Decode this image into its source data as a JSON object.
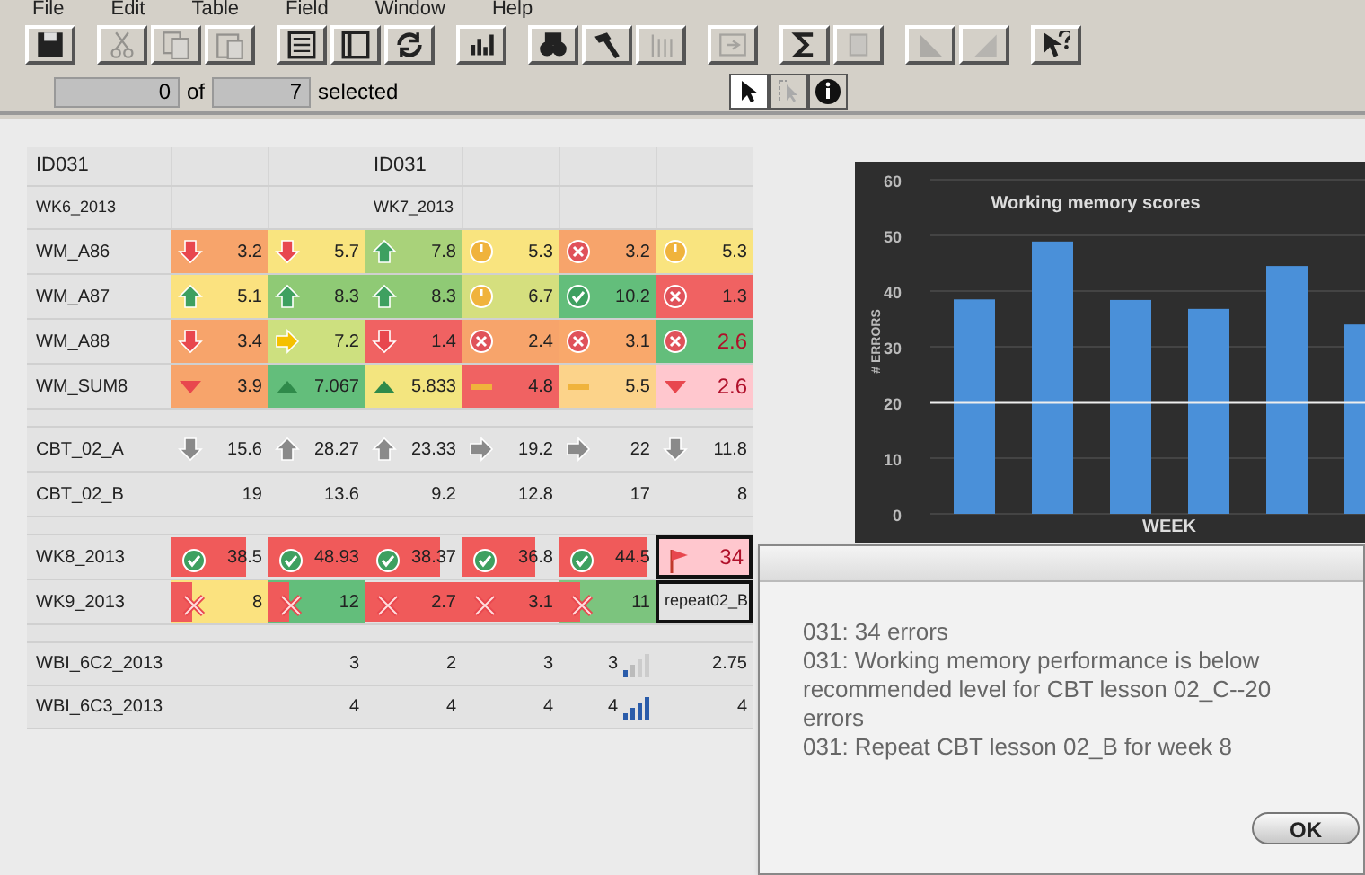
{
  "menu": [
    "File",
    "Edit",
    "Table",
    "Field",
    "Window",
    "Help"
  ],
  "toolbar": {
    "buttons": [
      {
        "kind": "save"
      },
      {
        "kind": "cut"
      },
      {
        "kind": "copy"
      },
      {
        "kind": "paste"
      },
      {
        "kind": "list"
      },
      {
        "kind": "form"
      },
      {
        "kind": "refresh"
      },
      {
        "kind": "chart"
      },
      {
        "kind": "find"
      },
      {
        "kind": "hammer"
      },
      {
        "kind": "sort"
      },
      {
        "kind": "import"
      },
      {
        "kind": "sum"
      },
      {
        "kind": "page"
      },
      {
        "kind": "triangle"
      },
      {
        "kind": "triangle2"
      },
      {
        "kind": "help"
      }
    ]
  },
  "selection": {
    "count": "0",
    "of": "of",
    "total": "7",
    "label": "selected"
  },
  "tools": [
    {
      "kind": "pointer",
      "selected": true
    },
    {
      "kind": "select",
      "selected": false
    },
    {
      "kind": "info",
      "selected": false
    }
  ],
  "header": [
    {
      "id": "ID031",
      "week": "WK6_2013"
    },
    {
      "id": "ID031",
      "week": "WK7_2013"
    }
  ],
  "rows": [
    {
      "kind": "heat",
      "label": "WM_A86",
      "cells": [
        {
          "kind": "down",
          "color": "#f7a46b",
          "value": "3.2",
          "alert": false
        },
        {
          "kind": "down",
          "color": "#f9e47f",
          "value": "5.7",
          "alert": false
        },
        {
          "kind": "up",
          "color": "#a9d27a",
          "value": "7.8",
          "alert": false
        },
        {
          "kind": "neutral",
          "color": "#f9e47f",
          "value": "5.3",
          "alert": false
        },
        {
          "kind": "cross",
          "color": "#f7a46b",
          "value": "3.2",
          "alert": false
        },
        {
          "kind": "neutral",
          "color": "#f9e47f",
          "value": "5.3",
          "alert": false
        }
      ]
    },
    {
      "kind": "heat",
      "label": "WM_A87",
      "cells": [
        {
          "kind": "up",
          "color": "#fbe27f",
          "value": "5.1",
          "alert": false
        },
        {
          "kind": "up",
          "color": "#8fca75",
          "value": "8.3",
          "alert": false
        },
        {
          "kind": "up",
          "color": "#8fca75",
          "value": "8.3",
          "alert": false
        },
        {
          "kind": "neutral",
          "color": "#d5df7e",
          "value": "6.7",
          "alert": false
        },
        {
          "kind": "check",
          "color": "#63be7b",
          "value": "10.2",
          "alert": false
        },
        {
          "kind": "cross",
          "color": "#f06262",
          "value": "1.3",
          "alert": false
        }
      ]
    },
    {
      "kind": "heat",
      "label": "WM_A88",
      "cells": [
        {
          "kind": "down",
          "color": "#f7a46b",
          "value": "3.4",
          "alert": false
        },
        {
          "kind": "right",
          "color": "#cde07f",
          "value": "7.2",
          "alert": false
        },
        {
          "kind": "down",
          "color": "#f06262",
          "value": "1.4",
          "alert": false
        },
        {
          "kind": "cross",
          "color": "#f7a46b",
          "value": "2.4",
          "alert": false
        },
        {
          "kind": "cross",
          "color": "#f9a86b",
          "value": "3.1",
          "alert": false
        },
        {
          "kind": "cross",
          "color": "#63be7b",
          "value": "2.6",
          "alert": true
        }
      ]
    },
    {
      "kind": "heat",
      "label": "WM_SUM8",
      "cells": [
        {
          "kind": "tri-down",
          "color": "#f7a46b",
          "value": "3.9",
          "alert": false
        },
        {
          "kind": "tri-up",
          "color": "#63be7b",
          "value": "7.067",
          "alert": false
        },
        {
          "kind": "tri-up",
          "color": "#f3e57f",
          "value": "5.833",
          "alert": false
        },
        {
          "kind": "dash",
          "color": "#f06262",
          "value": "4.8",
          "alert": false
        },
        {
          "kind": "dash",
          "color": "#fcd38a",
          "value": "5.5",
          "alert": false
        },
        {
          "kind": "tri-down",
          "color": "#ffc7ce",
          "value": "2.6",
          "alert": true
        }
      ]
    },
    {
      "kind": "gap"
    },
    {
      "kind": "plain",
      "label": "CBT_02_A",
      "cells": [
        {
          "kind": "down",
          "value": "15.6"
        },
        {
          "kind": "up",
          "value": "28.27"
        },
        {
          "kind": "up",
          "value": "23.33"
        },
        {
          "kind": "right",
          "value": "19.2"
        },
        {
          "kind": "right",
          "value": "22"
        },
        {
          "kind": "down",
          "value": "11.8"
        }
      ]
    },
    {
      "kind": "plain",
      "label": "CBT_02_B",
      "cells": [
        {
          "value": "19"
        },
        {
          "value": "13.6"
        },
        {
          "value": "9.2"
        },
        {
          "value": "12.8"
        },
        {
          "value": "17"
        },
        {
          "value": "8"
        }
      ]
    },
    {
      "kind": "gap"
    },
    {
      "kind": "bars",
      "label": "WK8_2013",
      "cells": [
        {
          "kind": "check",
          "value": "38.5",
          "selected": false
        },
        {
          "kind": "check",
          "value": "48.93",
          "selected": false
        },
        {
          "kind": "check",
          "value": "38.37",
          "selected": false
        },
        {
          "kind": "check",
          "value": "36.8",
          "selected": false
        },
        {
          "kind": "check",
          "value": "44.5",
          "selected": false
        },
        {
          "kind": "flag",
          "color": "#ffc7ce",
          "value": "34",
          "alert": true,
          "selected": true
        }
      ]
    },
    {
      "kind": "bars",
      "label": "WK9_2013",
      "cells": [
        {
          "kind": "cross",
          "color": "#fbe27f",
          "value": "8",
          "selected": false
        },
        {
          "kind": "cross",
          "color": "#63be7b",
          "value": "12",
          "selected": false
        },
        {
          "kind": "cross",
          "value": "2.7",
          "selected": false
        },
        {
          "kind": "cross",
          "value": "3.1",
          "selected": false
        },
        {
          "kind": "cross",
          "color": "#7cc47e",
          "value": "11",
          "selected": false
        },
        {
          "kind": "note",
          "value": "repeat02_B",
          "selected": true
        }
      ]
    },
    {
      "kind": "gap"
    },
    {
      "kind": "score",
      "label": "WBI_6C2_2013",
      "cells": [
        {
          "value": "3"
        },
        {
          "value": "2"
        },
        {
          "value": "3"
        },
        {
          "value": "3",
          "kind": "bars-low"
        },
        {
          "value": "2.75"
        }
      ]
    },
    {
      "kind": "score",
      "label": "WBI_6C3_2013",
      "cells": [
        {
          "value": "4"
        },
        {
          "value": "4"
        },
        {
          "value": "4"
        },
        {
          "value": "4",
          "kind": "bars-full"
        },
        {
          "value": "4"
        }
      ]
    }
  ],
  "chart": {
    "chart_data": {
      "type": "bar",
      "title": "Working memory scores",
      "xlabel": "WEEK",
      "ylabel": "# ERRORS",
      "series": [
        {
          "color": "#4a90d9",
          "values": [
            38.5,
            48.9,
            38.4,
            36.8,
            44.5,
            34
          ]
        }
      ],
      "ylim": [
        0,
        60
      ],
      "yticks": [
        0,
        10,
        20,
        30,
        40,
        50,
        60
      ],
      "grid": true,
      "ref_lines": [
        {
          "axis": "y",
          "value": 20
        }
      ]
    }
  },
  "dialog": {
    "lines": [
      "031: 34 errors",
      "031: Working memory performance is below recommended level for CBT lesson 02_C--20 errors",
      "031: Repeat CBT lesson 02_B for week 8"
    ],
    "button": "OK"
  }
}
